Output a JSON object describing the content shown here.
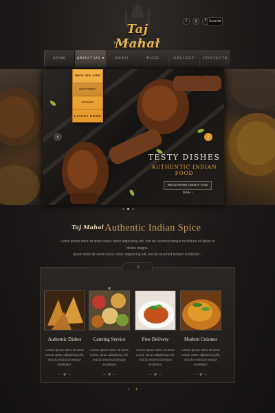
{
  "brand": {
    "name": "Taj Mahal",
    "tagline": "INDIAN RESTAURANT"
  },
  "header": {
    "social": [
      {
        "name": "twitter",
        "glyph": "t"
      },
      {
        "name": "google-plus",
        "glyph": "g"
      },
      {
        "name": "facebook",
        "glyph": "f"
      }
    ],
    "search_placeholder": "Search"
  },
  "nav": {
    "items": [
      {
        "label": "HOME"
      },
      {
        "label": "ABOUT US ▾"
      },
      {
        "label": "MENU"
      },
      {
        "label": "BLOG"
      },
      {
        "label": "GALLERY"
      },
      {
        "label": "CONTACTS"
      }
    ],
    "active_index": 1,
    "dropdown": [
      "WHO WE ARE",
      "HISTORY",
      "STAFF",
      "LATEST NEWS"
    ]
  },
  "hero": {
    "title": "TESTY DISHES",
    "subtitle": "AUTHENTIC INDIAN FOOD",
    "button": "READ MORE ABOUT THIS DISH ›",
    "slides": 3,
    "active_slide": 1
  },
  "intro": {
    "logo": "Taj Mahal",
    "dash": "-",
    "title": "Authentic Indian Spice",
    "lines": [
      "Lorem ipsum dolor sit amet conse ctetur adipisicing elit, sed do eiusmod tempor incididunt ut labore et dolore magna.",
      "Ipsum dolor sit amet conse ctetur adipisicing elit, sed do eiusmod tempor incididunt..."
    ]
  },
  "services": [
    {
      "title": "Authentic Dishes",
      "text": "Lorem ipsum dolor sit amet conse ctetur adipisicing elit, sed do eiusmod tempor incididunt."
    },
    {
      "title": "Catering Service",
      "text": "Lorem ipsum dolor sit amet conse ctetur adipisicing elit, sed do eiusmod tempor incididunt."
    },
    {
      "title": "Free Delivery",
      "text": "Lorem ipsum dolor sit amet conse ctetur adipisicing elit, sed do eiusmod tempor incididunt."
    },
    {
      "title": "Modern Cuisines",
      "text": "Lorem ipsum dolor sit amet conse ctetur adipisicing elit, sed do eiusmod tempor incididunt."
    }
  ],
  "pager": {
    "prev": "‹",
    "next": "›"
  },
  "colors": {
    "accent": "#e49a2c",
    "gold_text": "#c9a15a",
    "background": "#1c1918"
  }
}
